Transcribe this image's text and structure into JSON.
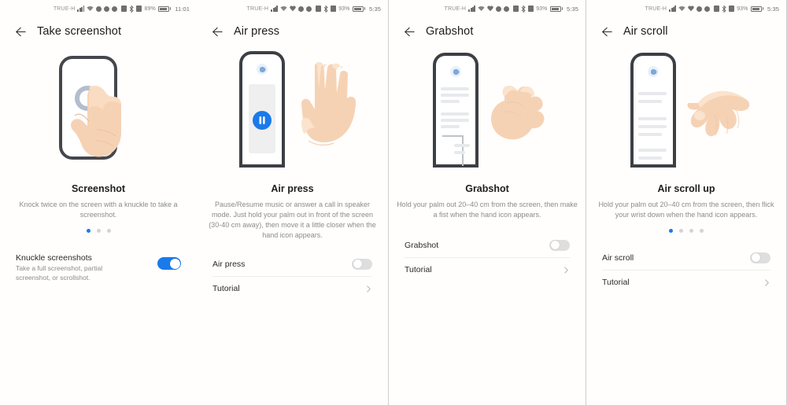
{
  "screens": [
    {
      "status": {
        "carrier": "TRUE-H",
        "battery_pct": "89%",
        "time": "11:01"
      },
      "title": "Take screenshot",
      "illustration": "knuckle-tap-phone-illustration",
      "caption_title": "Screenshot",
      "caption_desc": "Knock twice on the screen with a knuckle to take a screenshot.",
      "dots": {
        "count": 3,
        "active": 0
      },
      "rows": [
        {
          "type": "toggle_with_sub",
          "label": "Knuckle screenshots",
          "sub": "Take a full screenshot, partial screenshot, or scrollshot.",
          "toggle": "on"
        }
      ]
    },
    {
      "status": {
        "carrier": "TRUE-H",
        "battery_pct": "93%",
        "time": "5:35"
      },
      "title": "Air press",
      "illustration": "air-press-phone-and-open-palm-illustration",
      "caption_title": "Air press",
      "caption_desc": "Pause/Resume music or answer a call in speaker mode. Just hold your palm out in front of the screen (30-40 cm away), then move it a little closer when the hand icon appears.",
      "dots": {
        "count": 0,
        "active": -1
      },
      "rows": [
        {
          "type": "toggle",
          "label": "Air press",
          "toggle": "off"
        },
        {
          "type": "chevron",
          "label": "Tutorial"
        }
      ]
    },
    {
      "status": {
        "carrier": "TRUE-H",
        "battery_pct": "93%",
        "time": "5:35"
      },
      "title": "Grabshot",
      "illustration": "grabshot-phone-and-fist-illustration",
      "caption_title": "Grabshot",
      "caption_desc": "Hold your palm out 20–40 cm from the screen, then make a fist when the hand icon appears.",
      "dots": {
        "count": 0,
        "active": -1
      },
      "rows": [
        {
          "type": "toggle",
          "label": "Grabshot",
          "toggle": "off"
        },
        {
          "type": "chevron",
          "label": "Tutorial"
        }
      ]
    },
    {
      "status": {
        "carrier": "TRUE-H",
        "battery_pct": "93%",
        "time": "5:35"
      },
      "title": "Air scroll",
      "illustration": "air-scroll-phone-and-flicking-hand-illustration",
      "caption_title": "Air scroll up",
      "caption_desc": "Hold your palm out 20–40 cm from the screen, then flick your wrist down when the hand icon appears.",
      "dots": {
        "count": 4,
        "active": 0
      },
      "rows": [
        {
          "type": "toggle",
          "label": "Air scroll",
          "toggle": "off"
        },
        {
          "type": "chevron",
          "label": "Tutorial"
        }
      ]
    }
  ],
  "colors": {
    "accent": "#1b7aea",
    "text_primary": "#1d1d1d",
    "text_secondary": "#8b8b8b",
    "toggle_off": "#dedede",
    "divider": "#ededed",
    "skin": "#f6d2b4",
    "phone_frame": "#44484d"
  }
}
